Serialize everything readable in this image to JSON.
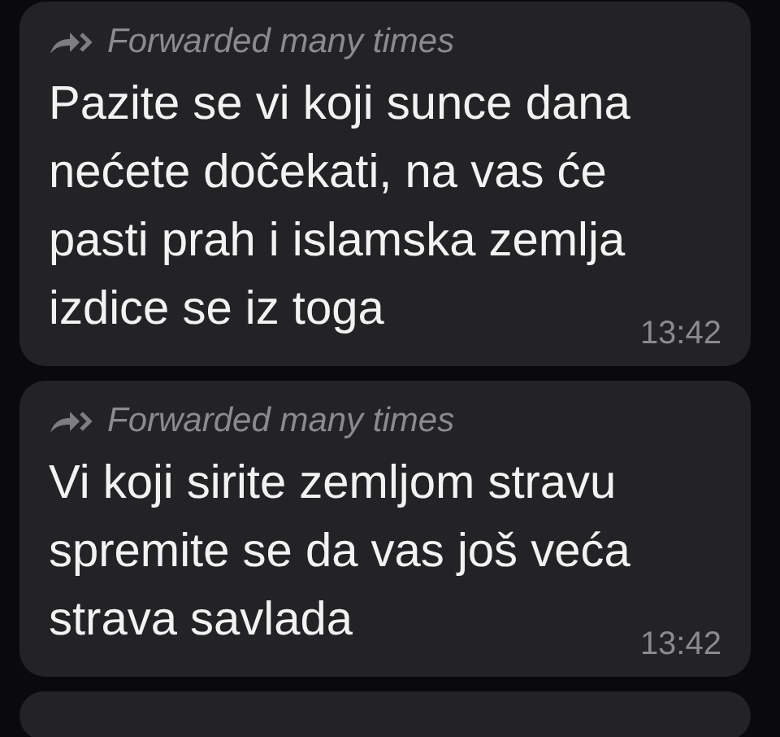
{
  "messages": [
    {
      "forwarded_label": "Forwarded many times",
      "lines": [
        "Pazite se vi koji sunce dana",
        "nećete dočekati, na vas će",
        "pasti prah i islamska zemlja",
        "izdice se iz toga"
      ],
      "time": "13:42"
    },
    {
      "forwarded_label": "Forwarded many times",
      "lines": [
        "Vi koji sirite zemljom stravu",
        "spremite se da vas još veća",
        "strava savlada"
      ],
      "time": "13:42"
    }
  ]
}
